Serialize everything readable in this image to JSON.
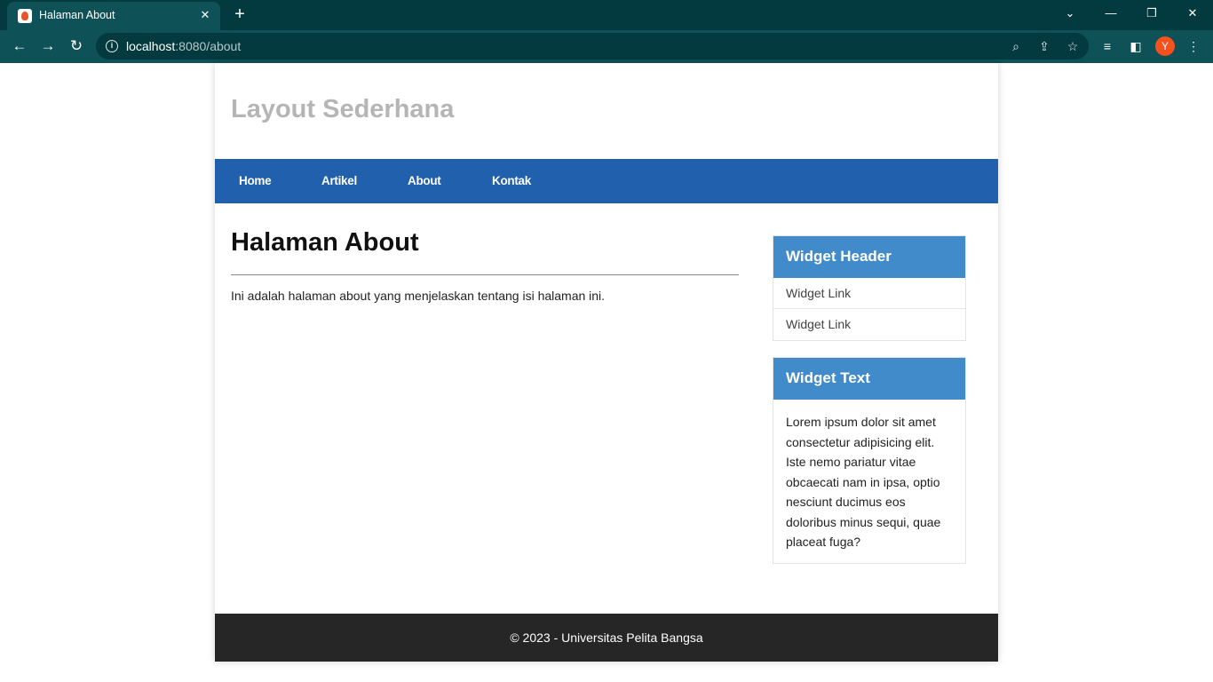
{
  "browser": {
    "tab_title": "Halaman About",
    "url_host": "localhost",
    "url_rest": ":8080/about",
    "avatar_letter": "Y",
    "accent_color": "#0e5257"
  },
  "page": {
    "site_title": "Layout Sederhana",
    "nav": [
      "Home",
      "Artikel",
      "About",
      "Kontak"
    ],
    "heading": "Halaman About",
    "body_text": "Ini adalah halaman about yang menjelaskan tentang isi halaman ini.",
    "widget1": {
      "header": "Widget Header",
      "links": [
        "Widget Link",
        "Widget Link"
      ]
    },
    "widget2": {
      "header": "Widget Text",
      "text": "Lorem ipsum dolor sit amet consectetur adipisicing elit. Iste nemo pariatur vitae obcaecati nam in ipsa, optio nesciunt ducimus eos doloribus minus sequi, quae placeat fuga?"
    },
    "footer": "© 2023 - Universitas Pelita Bangsa",
    "colors": {
      "nav_bg": "#2160ad",
      "widget_header_bg": "#428bca",
      "footer_bg": "#262626",
      "site_title": "#b5b5b5"
    }
  }
}
